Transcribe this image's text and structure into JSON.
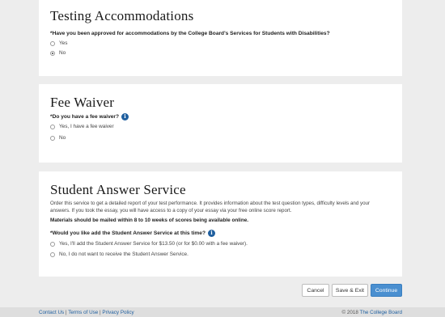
{
  "testing": {
    "title": "Testing Accommodations",
    "question": "*Have you been approved for accommodations by the College Board's Services for Students with Disabilities?",
    "options": [
      "Yes",
      "No"
    ],
    "selected": "No"
  },
  "fee_waiver": {
    "title": "Fee Waiver",
    "question": "*Do you have a fee waiver?",
    "options": [
      "Yes, I have a fee waiver",
      "No"
    ]
  },
  "answer_service": {
    "title": "Student Answer Service",
    "description": "Order this service to get a detailed report of your test performance. It provides information about the test question types, difficulty levels and your answers. If you took the essay, you will have access to a copy of your essay via your free online score report.",
    "notice": "Materials should be mailed within 8 to 10 weeks of scores being available online.",
    "question": "*Would you like add the Student Answer Service at this time?",
    "options": [
      "Yes, I'll add the Student Answer Service for $13.50 (or for $0.00 with a fee waiver).",
      "No, I do not want to receive the Student Answer Service."
    ]
  },
  "actions": {
    "cancel": "Cancel",
    "save_exit": "Save & Exit",
    "continue": "Continue"
  },
  "footer": {
    "contact": "Contact Us",
    "sep1": " | ",
    "terms": "Terms of Use",
    "sep2": " | ",
    "privacy": "Privacy Policy",
    "copyright": "© 2018",
    "org": "The College Board"
  },
  "icons": {
    "info": "info-icon"
  },
  "colors": {
    "accent": "#4a8fd0",
    "link": "#1f5f9f",
    "background": "#ededed"
  }
}
